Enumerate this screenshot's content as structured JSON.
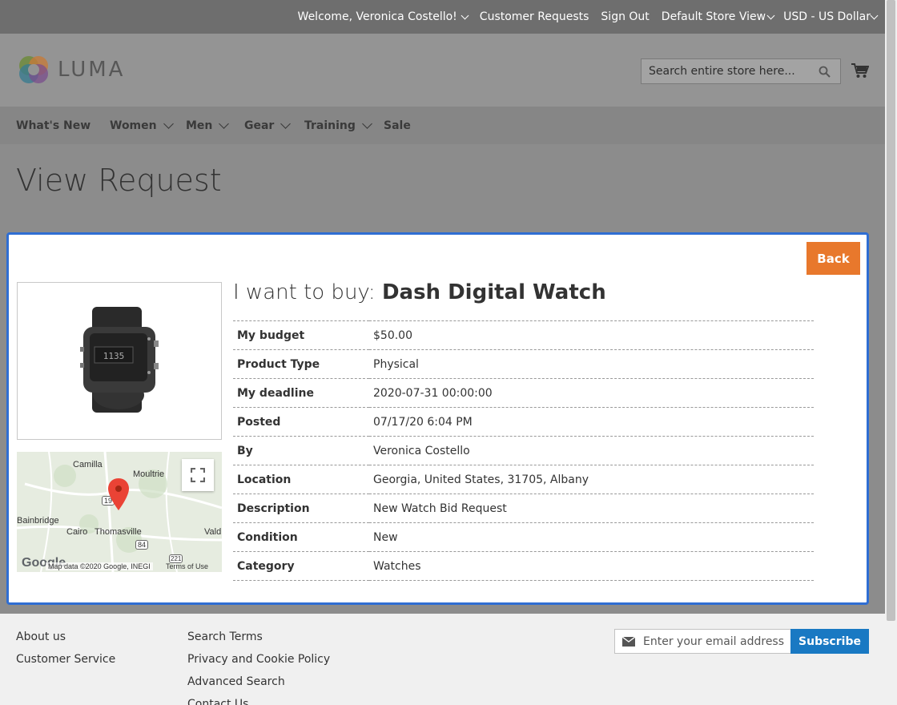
{
  "topbar": {
    "welcome": "Welcome, Veronica Costello!",
    "customer_requests": "Customer Requests",
    "sign_out": "Sign Out",
    "store_view": "Default Store View",
    "currency": "USD - US Dollar"
  },
  "header": {
    "logo_text": "LUMA",
    "search_placeholder": "Search entire store here...",
    "cart_label": "My Cart"
  },
  "nav": {
    "items": [
      {
        "label": "What's New"
      },
      {
        "label": "Women"
      },
      {
        "label": "Men"
      },
      {
        "label": "Gear"
      },
      {
        "label": "Training"
      },
      {
        "label": "Sale"
      }
    ]
  },
  "page": {
    "title": "View Request"
  },
  "modal": {
    "back_label": "Back",
    "title_prefix": "I want to buy:",
    "product_name": "Dash Digital Watch",
    "details": [
      {
        "key": "My budget",
        "value": "$50.00"
      },
      {
        "key": "Product Type",
        "value": "Physical"
      },
      {
        "key": "My deadline",
        "value": "2020-07-31 00:00:00"
      },
      {
        "key": "Posted",
        "value": "07/17/20 6:04 PM"
      },
      {
        "key": "By",
        "value": "Veronica Costello"
      },
      {
        "key": "Location",
        "value": "Georgia, United States, 31705, Albany"
      },
      {
        "key": "Description",
        "value": "New Watch Bid Request"
      },
      {
        "key": "Condition",
        "value": "New"
      },
      {
        "key": "Category",
        "value": "Watches"
      }
    ],
    "map": {
      "labels": [
        "Camilla",
        "Moultrie",
        "Bainbridge",
        "Cairo",
        "Thomasville",
        "Vald"
      ],
      "route_19": "19",
      "route_84": "84",
      "route_221": "221",
      "google": "Google",
      "attribution": "Map data ©2020 Google, INEGI",
      "terms": "Terms of Use"
    }
  },
  "footer": {
    "col1": [
      "About us",
      "Customer Service"
    ],
    "col2": [
      "Search Terms",
      "Privacy and Cookie Policy",
      "Advanced Search",
      "Contact Us"
    ],
    "newsletter_placeholder": "Enter your email address",
    "subscribe_label": "Subscribe"
  },
  "colors": {
    "accent": "#e8782c",
    "primary": "#1979c3",
    "modal_border": "#2f6ed3"
  }
}
